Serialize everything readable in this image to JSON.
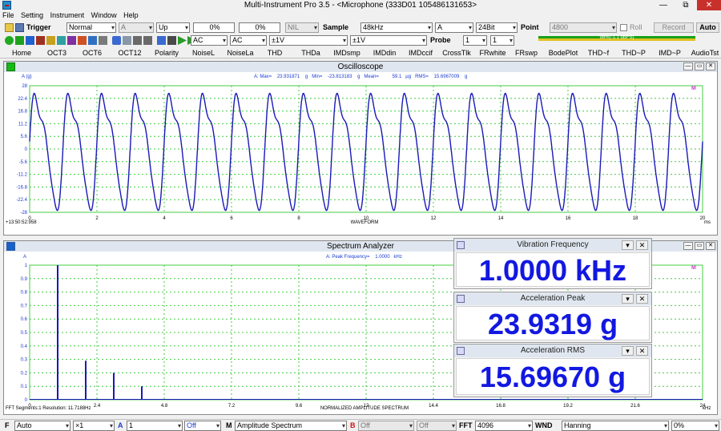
{
  "window": {
    "title": "Multi-Instrument Pro 3.5   -   <Microphone (333D01 105486131653>",
    "controls": {
      "minimize": "—",
      "maximize": "⧉",
      "close": "✕"
    }
  },
  "menu": [
    "File",
    "Setting",
    "Instrument",
    "Window",
    "Help"
  ],
  "toolbar1": {
    "trigger_label": "Trigger",
    "trigger_mode": "Normal",
    "trigger_channel": "A",
    "trigger_edge": "Up",
    "trigger_level": "0%",
    "trigger_pre": "0%",
    "nil": "NIL",
    "sample_label": "Sample",
    "sample_rate": "48kHz",
    "channel": "A",
    "bits": "24Bit",
    "point_label": "Point",
    "point_value": "4800",
    "roll_label": "Roll",
    "record_label": "Record",
    "auto_label": "Auto"
  },
  "toolbar2": {
    "coupling_a": "AC",
    "coupling_b": "AC",
    "range_a": "±1V",
    "range_b": "±1V",
    "probe_label": "Probe",
    "probe_a": "1",
    "probe_b": "1",
    "level_text": "98%(-1.1 dBFS)"
  },
  "tabs": [
    "Home",
    "OCT3",
    "OCT6",
    "OCT12",
    "Polarity",
    "NoiseL",
    "NoiseLa",
    "THD",
    "THDa",
    "IMDsmp",
    "IMDdin",
    "IMDccif",
    "CrossTlk",
    "FRwhite",
    "FRswp",
    "BodePlot",
    "THD~f",
    "THD~P",
    "IMD~P",
    "AudioTst"
  ],
  "oscilloscope": {
    "title": "Oscilloscope",
    "ylabel": "A (g)",
    "stats": "A: Max=    23.931871    g   Min=    -23.813183    g   Mean=          59.1   µg   RMS=    15.6967009    g",
    "timestamp": "+13:50:52:958",
    "caption": "WAVEFORM",
    "xunit": "ms",
    "marker": "M",
    "chart_data": {
      "type": "line",
      "title": "Oscilloscope",
      "xlabel": "WAVEFORM",
      "ylabel": "A (g)",
      "x_unit": "ms",
      "xlim": [
        0,
        20
      ],
      "ylim": [
        -28,
        28
      ],
      "x_ticks": [
        "0",
        "2",
        "4",
        "6",
        "8",
        "10",
        "12",
        "14",
        "16",
        "18",
        "20"
      ],
      "y_ticks": [
        "28",
        "22.4",
        "16.8",
        "11.2",
        "5.6",
        "0",
        "-5.6",
        "-11.2",
        "-16.8",
        "-22.4",
        "-28"
      ],
      "series": [
        {
          "signal": "distorted sine",
          "frequency_hz": 1000,
          "peak_g": 23.93,
          "min_g": -23.81,
          "rms_g": 15.697,
          "cycles_shown": 20
        }
      ]
    }
  },
  "spectrum": {
    "title": "Spectrum Analyzer",
    "ylabel": "A",
    "stats": "A: Peak Frequency=    1.0000   kHz",
    "segments": "FFT Segments:1      Resolution: 11.7188Hz",
    "caption": "NORMALIZED AMPLITUDE SPECTRUM",
    "xunit": "kHz",
    "marker": "M",
    "chart_data": {
      "type": "bar",
      "title": "Spectrum Analyzer",
      "xlabel": "NORMALIZED AMPLITUDE SPECTRUM",
      "ylabel": "A",
      "x_unit": "kHz",
      "xlim": [
        0,
        24
      ],
      "ylim": [
        0,
        1
      ],
      "x_ticks": [
        "0",
        "2.4",
        "4.8",
        "7.2",
        "9.6",
        "12",
        "14.4",
        "16.8",
        "19.2",
        "21.6",
        "24"
      ],
      "y_ticks": [
        "1",
        "0.9",
        "0.8",
        "0.7",
        "0.6",
        "0.5",
        "0.4",
        "0.3",
        "0.2",
        "0.1",
        "0"
      ],
      "peaks": [
        {
          "freq_khz": 1.0,
          "amplitude": 1.0
        },
        {
          "freq_khz": 2.0,
          "amplitude": 0.29
        },
        {
          "freq_khz": 3.0,
          "amplitude": 0.2
        },
        {
          "freq_khz": 4.0,
          "amplitude": 0.1
        }
      ]
    }
  },
  "meters": [
    {
      "title": "Vibration Frequency",
      "value": "1.0000 kHz"
    },
    {
      "title": "Acceleration Peak",
      "value": "23.9319  g"
    },
    {
      "title": "Acceleration RMS",
      "value": "15.69670 g"
    }
  ],
  "statusbar": {
    "f_label": "F",
    "f_value": "Auto",
    "mult": "×1",
    "a_label": "A",
    "a_value": "1",
    "off1": "Off",
    "m_label": "M",
    "mode": "Amplitude Spectrum",
    "b_label": "B",
    "b_value": "Off",
    "off2": "Off",
    "fft_label": "FFT",
    "fft_size": "4096",
    "wnd_label": "WND",
    "window": "Hanning",
    "overlap": "0%"
  },
  "colors": {
    "trace": "#1a1ab8",
    "grid": "#44cc44",
    "meter_value": "#1218e0",
    "stats_text": "#1a3ad0"
  },
  "icons": [
    "app-icon",
    "open-icon",
    "save-icon",
    "run-icon",
    "stop-icon",
    "generator-icon",
    "speaker-icon",
    "play-icon"
  ]
}
